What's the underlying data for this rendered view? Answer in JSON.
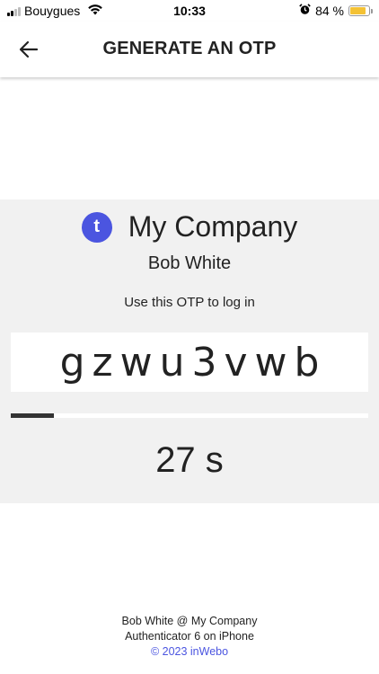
{
  "status_bar": {
    "carrier": "Bouygues",
    "time": "10:33",
    "battery_percent": "84 %",
    "battery_level": 0.84
  },
  "header": {
    "title": "GENERATE AN OTP"
  },
  "card": {
    "logo_letter": "t",
    "company_name": "My Company",
    "user_name": "Bob White",
    "instruction": "Use this OTP to log in",
    "otp": "gzwu3vwb",
    "time_remaining_fraction": 0.12,
    "timer_text": "27 s"
  },
  "footer": {
    "account": "Bob White @ My Company",
    "app_info": "Authenticator 6 on iPhone",
    "copyright": "© 2023 inWebo"
  },
  "colors": {
    "accent": "#4b55e0",
    "card_bg": "#f1f1f1",
    "battery": "#f4c235"
  }
}
